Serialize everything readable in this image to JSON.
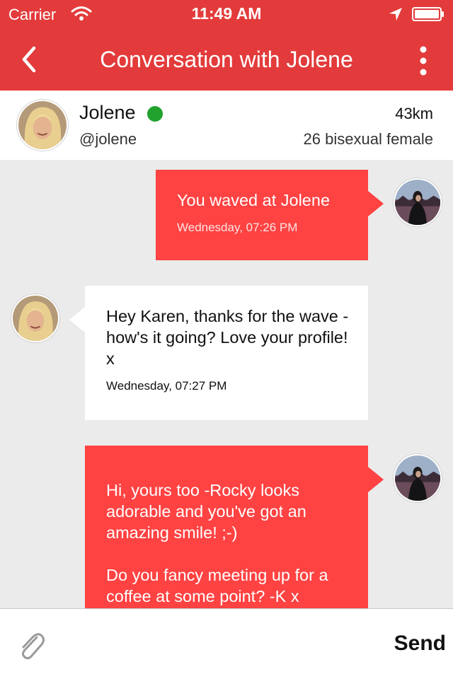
{
  "status_bar": {
    "carrier": "Carrier",
    "time": "11:49 AM"
  },
  "nav": {
    "title": "Conversation with Jolene",
    "back_icon": "chevron-left-icon",
    "more_icon": "more-vertical-icon"
  },
  "profile": {
    "name": "Jolene",
    "handle": "@jolene",
    "distance": "43km",
    "info": "26 bisexual female",
    "online": true
  },
  "messages": [
    {
      "direction": "outgoing",
      "text": "You waved at Jolene",
      "time": "Wednesday, 07:26 PM"
    },
    {
      "direction": "incoming",
      "text": "Hey Karen, thanks for the wave - how's it going? Love your profile! x",
      "time": "Wednesday, 07:27 PM"
    },
    {
      "direction": "outgoing",
      "text": "Hi, yours too -Rocky looks adorable and you've got an amazing smile! ;-)\n\nDo you fancy meeting up for a coffee at some point? -K x",
      "time": ""
    }
  ],
  "composer": {
    "attach_icon": "paperclip-icon",
    "send_label": "Send"
  },
  "colors": {
    "header": "#e33b3b",
    "outgoing_bubble": "#ff4242",
    "incoming_bubble": "#ffffff",
    "online": "#21a12e",
    "background": "#ebebeb"
  }
}
